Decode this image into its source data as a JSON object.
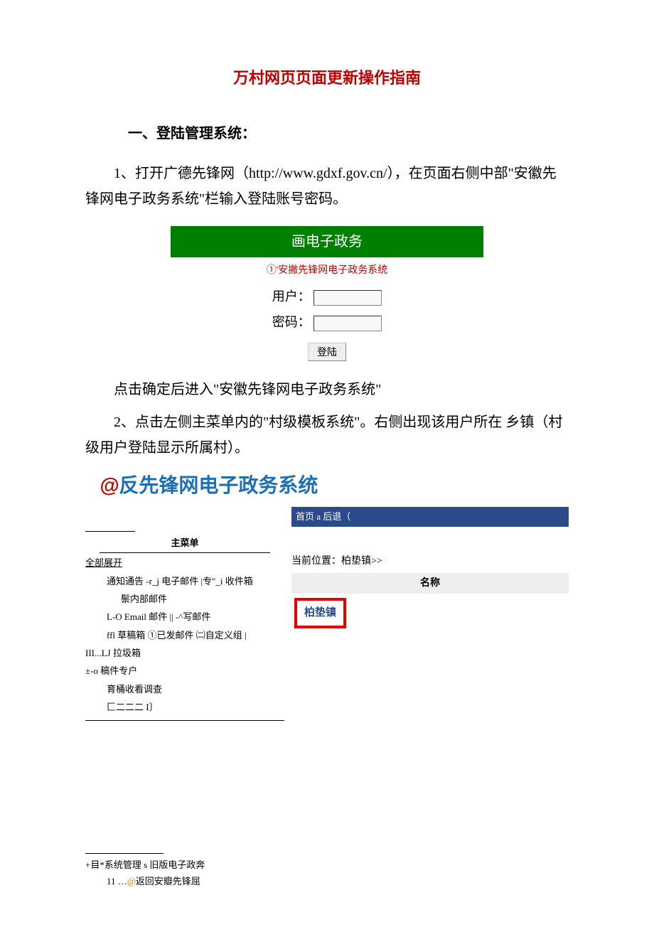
{
  "doc": {
    "title": "万村网页页面更新操作指南",
    "section1": "一、登陆管理系统：",
    "para1": "1、打开广德先锋网（http://www.gdxf.gov.cn/），在页面右侧中部\"安徽先锋网电子政务系统\"栏输入登陆账号密码。",
    "para2": "点击确定后进入\"安徽先锋网电子政务系统\"",
    "para3": "2、点击左侧主菜单内的\"村级模板系统\"。右侧出现该用户所在 乡镇（村级用户登陆显示所属村）。"
  },
  "login": {
    "header": "画电子政务",
    "sub": "①'安撇先锋网电子政务系统",
    "user_label": "用户：",
    "pass_label": "密码：",
    "btn": "登陆"
  },
  "system": {
    "at": "@",
    "title": "反先锋网电子政务系统",
    "bluebar": "首页 a 后退（"
  },
  "sidebar": {
    "header": "主菜单",
    "expand": "全部展开",
    "items": [
      "通知通告 -r_j 电子邮件 |专\"_i 收件箱",
      "鬃内部邮件",
      "L-O Email 邮件 || -^写邮件",
      "ffl 草稿箱 ①已发邮件 ㈡自定义组 |",
      "III...LJ 拉圾箱"
    ],
    "group2_head": "±-o 稿件专户",
    "group2_items": [
      "育桶收看调查",
      "匚二二二 I〕"
    ]
  },
  "right": {
    "location_label": "当前位置：",
    "location_value": "柏垫镇>>",
    "name_header": "名称",
    "redbox": "柏垫镇"
  },
  "footer": {
    "line1": "+目*系统管理 s 旧版电子政奔",
    "line2_prefix": "11 …",
    "line2_orange": "@",
    "line2_rest": "返回安瓣先锋屈"
  }
}
